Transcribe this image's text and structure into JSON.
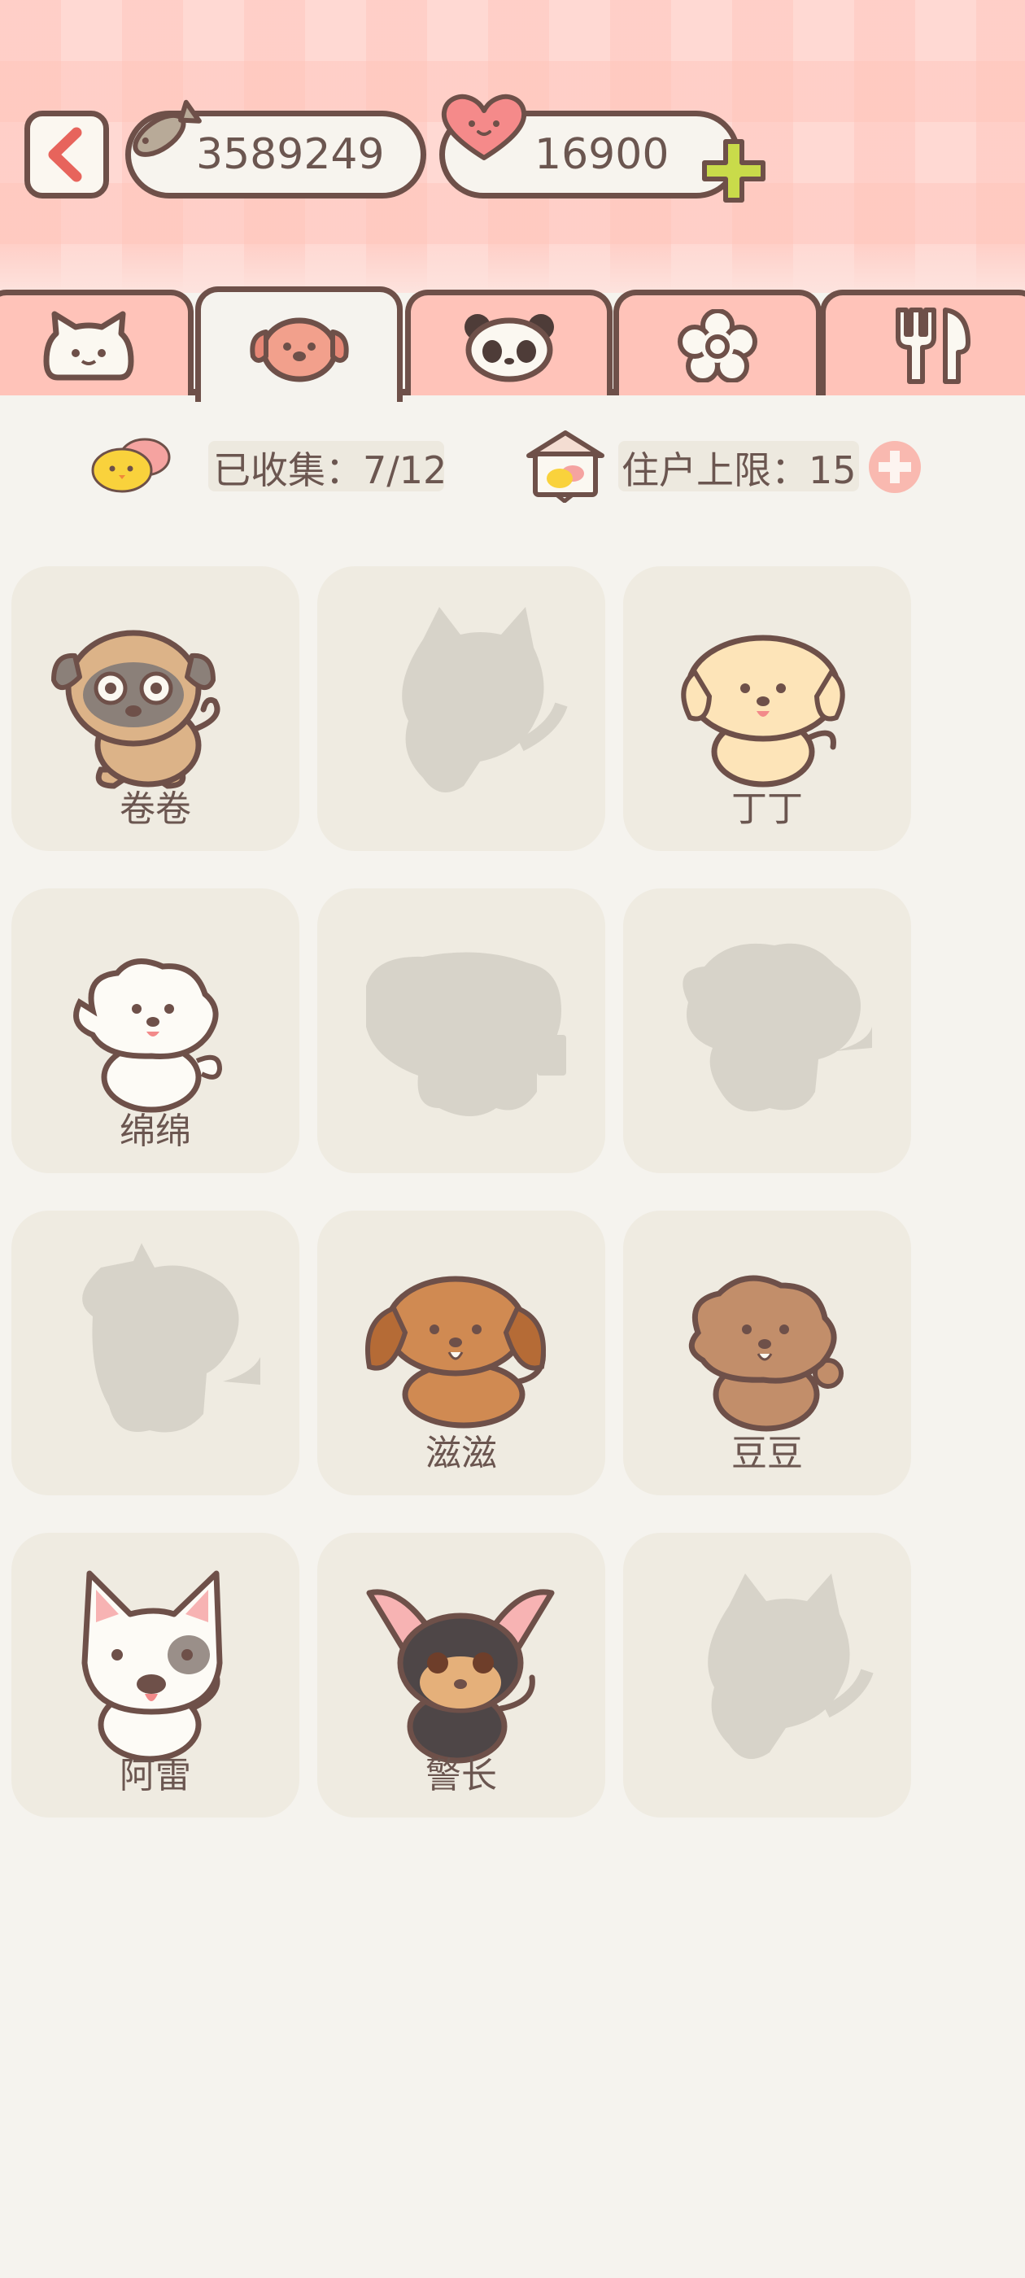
{
  "header": {
    "fish_currency": "3589249",
    "heart_currency": "16900",
    "colors": {
      "background": "#ffd9d3",
      "outline": "#6e5049",
      "plus": "#c9db4a"
    }
  },
  "tabs": [
    {
      "icon": "cat-icon",
      "active": false
    },
    {
      "icon": "dog-icon",
      "active": true
    },
    {
      "icon": "panda-icon",
      "active": false
    },
    {
      "icon": "flower-icon",
      "active": false
    },
    {
      "icon": "fork-knife-icon",
      "active": false
    }
  ],
  "stats": {
    "collected_label": "已收集：7/12",
    "capacity_label": "住户上限：15"
  },
  "pets": [
    {
      "name": "卷卷",
      "unlocked": true,
      "breed": "pug"
    },
    {
      "name": "",
      "unlocked": false,
      "breed": "silhouette"
    },
    {
      "name": "丁丁",
      "unlocked": true,
      "breed": "golden"
    },
    {
      "name": "绵绵",
      "unlocked": true,
      "breed": "bichon"
    },
    {
      "name": "",
      "unlocked": false,
      "breed": "silhouette"
    },
    {
      "name": "",
      "unlocked": false,
      "breed": "silhouette"
    },
    {
      "name": "",
      "unlocked": false,
      "breed": "silhouette"
    },
    {
      "name": "滋滋",
      "unlocked": true,
      "breed": "dachshund"
    },
    {
      "name": "豆豆",
      "unlocked": true,
      "breed": "poodle"
    },
    {
      "name": "阿雷",
      "unlocked": true,
      "breed": "bullterrier"
    },
    {
      "name": "警长",
      "unlocked": true,
      "breed": "chihuahua"
    },
    {
      "name": "",
      "unlocked": false,
      "breed": "silhouette"
    }
  ]
}
